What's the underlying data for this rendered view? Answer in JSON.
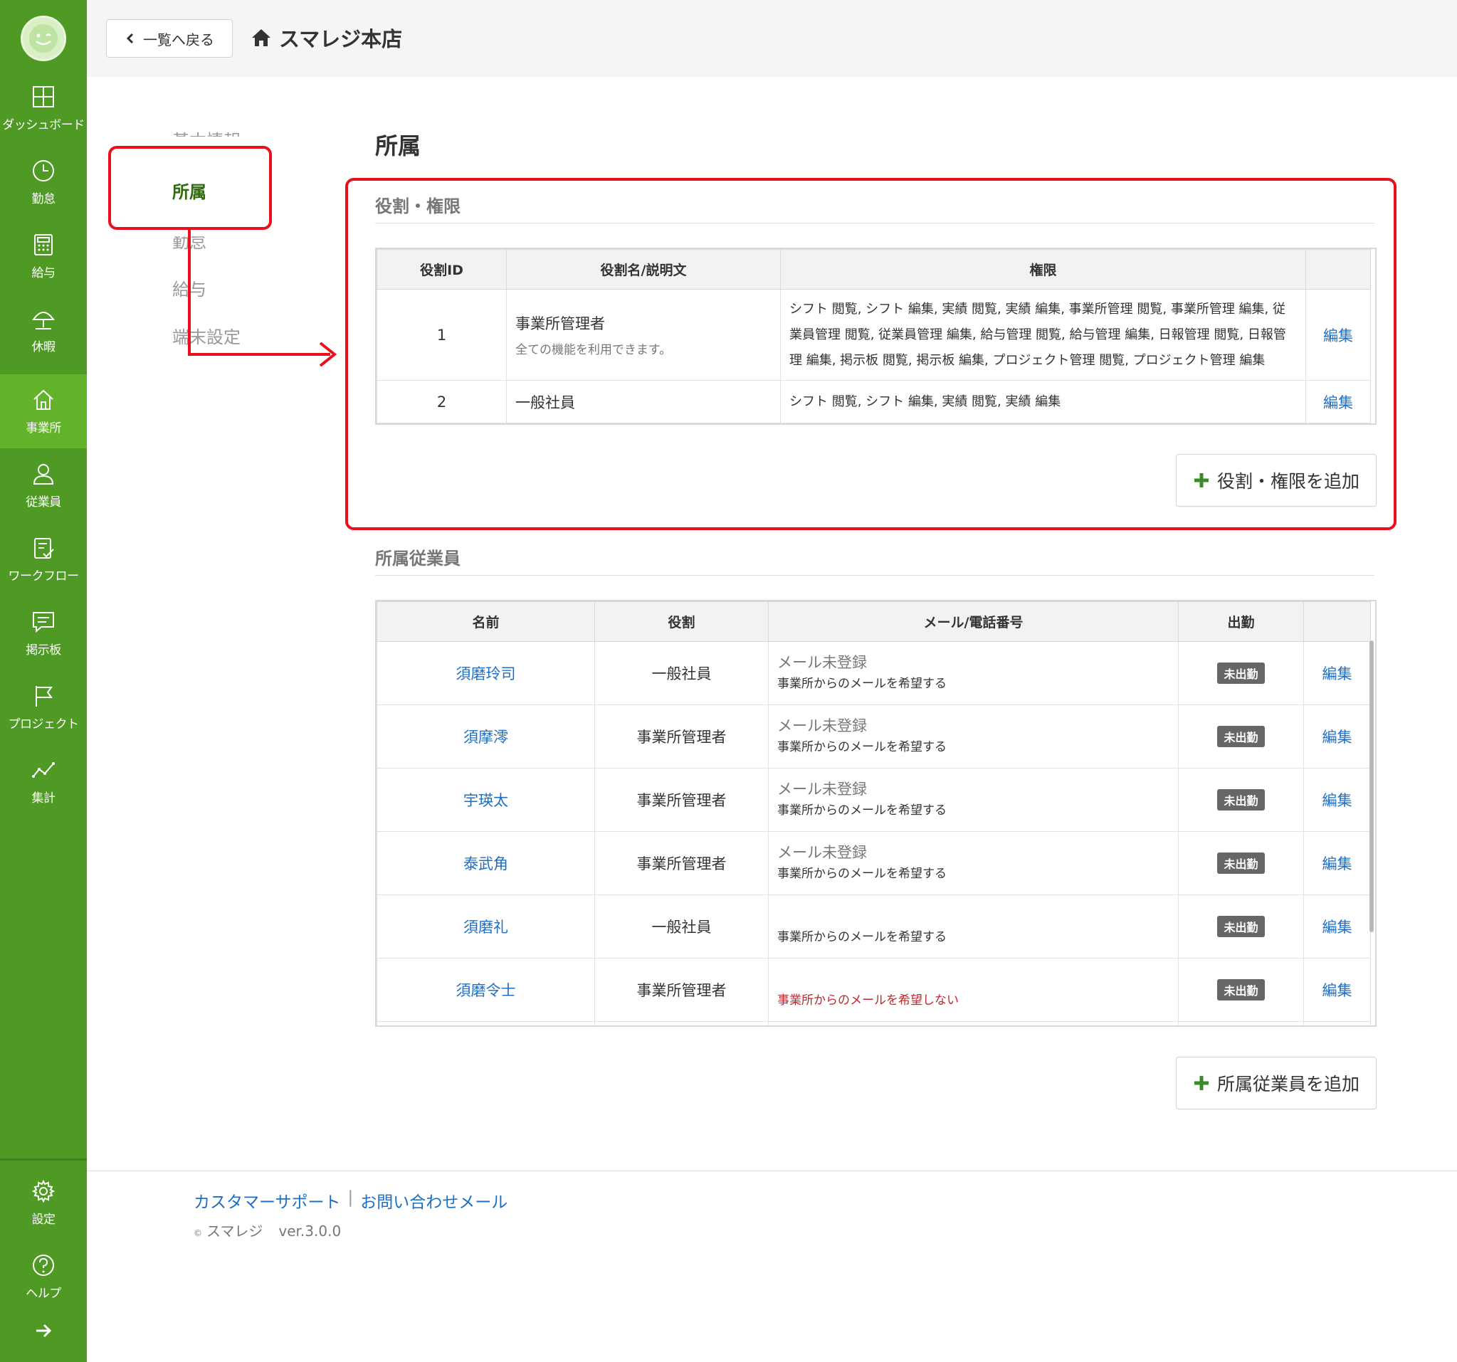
{
  "sidebar": {
    "items": [
      {
        "label": "ダッシュボード",
        "icon": "dashboard-icon"
      },
      {
        "label": "勤怠",
        "icon": "clock-icon"
      },
      {
        "label": "給与",
        "icon": "calculator-icon"
      },
      {
        "label": "休暇",
        "icon": "umbrella-icon"
      },
      {
        "label": "事業所",
        "icon": "home-icon"
      },
      {
        "label": "従業員",
        "icon": "person-icon"
      },
      {
        "label": "ワークフロー",
        "icon": "clipboard-check-icon"
      },
      {
        "label": "掲示板",
        "icon": "chat-icon"
      },
      {
        "label": "プロジェクト",
        "icon": "flag-icon"
      },
      {
        "label": "集計",
        "icon": "line-chart-icon"
      }
    ],
    "bottom_items": [
      {
        "label": "設定",
        "icon": "gear-icon"
      },
      {
        "label": "ヘルプ",
        "icon": "question-icon"
      }
    ],
    "active_color": "#62b22a",
    "bg_color": "#4e9a24"
  },
  "header": {
    "back_label": "一覧へ戻る",
    "store_name": "スマレジ本店"
  },
  "subnav": {
    "items": [
      "基本情報",
      "所属",
      "勤怠",
      "給与",
      "端末設定"
    ]
  },
  "main": {
    "page_title": "所属",
    "roles": {
      "title": "役割・権限",
      "columns": [
        "役割ID",
        "役割名/説明文",
        "権限",
        ""
      ],
      "rows": [
        {
          "id": "1",
          "name": "事業所管理者",
          "desc": "全ての機能を利用できます。",
          "perms": "シフト 閲覧, シフト 編集, 実績 閲覧, 実績 編集, 事業所管理 閲覧, 事業所管理 編集, 従業員管理 閲覧, 従業員管理 編集, 給与管理 閲覧, 給与管理 編集, 日報管理 閲覧, 日報管理 編集, 掲示板 閲覧, 掲示板 編集, プロジェクト管理 閲覧, プロジェクト管理 編集",
          "edit": "編集"
        },
        {
          "id": "2",
          "name": "一般社員",
          "desc": "",
          "perms": "シフト 閲覧, シフト 編集, 実績 閲覧, 実績 編集",
          "edit": "編集"
        }
      ],
      "add_label": "役割・権限を追加"
    },
    "employees": {
      "title": "所属従業員",
      "columns": [
        "名前",
        "役割",
        "メール/電話番号",
        "出勤",
        ""
      ],
      "rows": [
        {
          "name": "須磨玲司",
          "role": "一般社員",
          "mail": "メール未登録",
          "pref": "事業所からのメールを希望する",
          "status": "未出勤",
          "edit": "編集"
        },
        {
          "name": "須摩澪",
          "role": "事業所管理者",
          "mail": "メール未登録",
          "pref": "事業所からのメールを希望する",
          "status": "未出勤",
          "edit": "編集"
        },
        {
          "name": "宇瑛太",
          "role": "事業所管理者",
          "mail": "メール未登録",
          "pref": "事業所からのメールを希望する",
          "status": "未出勤",
          "edit": "編集"
        },
        {
          "name": "泰武角",
          "role": "事業所管理者",
          "mail": "メール未登録",
          "pref": "事業所からのメールを希望する",
          "status": "未出勤",
          "edit": "編集"
        },
        {
          "name": "須磨礼",
          "role": "一般社員",
          "mail": "",
          "pref": "事業所からのメールを希望する",
          "status": "未出勤",
          "edit": "編集"
        },
        {
          "name": "須磨令士",
          "role": "事業所管理者",
          "mail": "",
          "pref": "事業所からのメールを希望しない",
          "status": "未出勤",
          "edit": "編集",
          "pref_negative": true
        }
      ],
      "add_label": "所属従業員を追加"
    }
  },
  "footer": {
    "support_label": "カスタマーサポート",
    "separator": "|",
    "contact_label": "お問い合わせメール",
    "copyright_mark": "©",
    "brand": "スマレジ",
    "version": "ver.3.0.0"
  },
  "colors": {
    "highlight": "#e8101c",
    "link": "#1e6fc4",
    "negative": "#c0282e",
    "plus": "#3c8a2a"
  }
}
